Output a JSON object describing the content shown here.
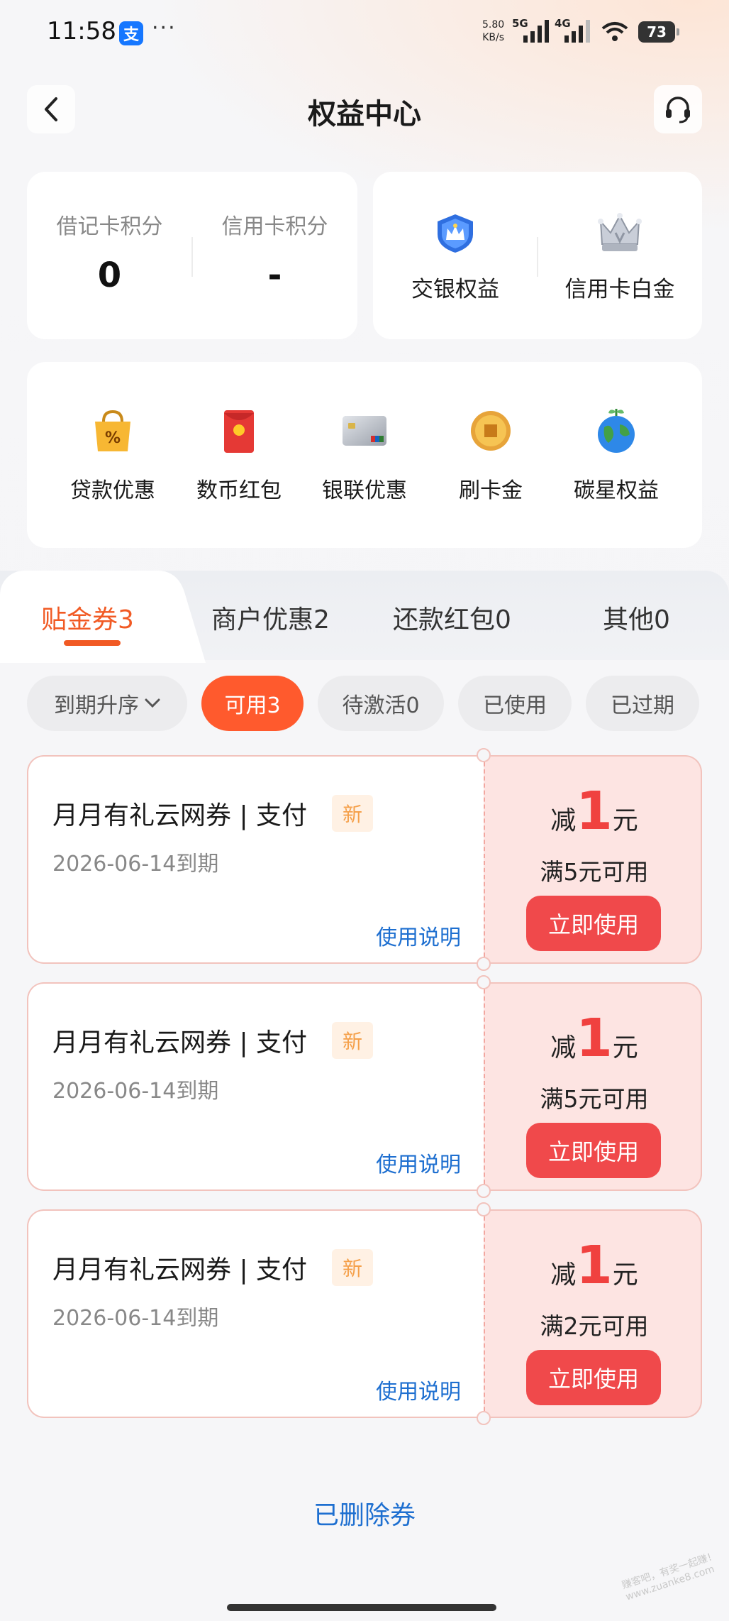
{
  "status": {
    "time": "11:58",
    "net_speed_value": "5.80",
    "net_speed_unit": "KB/s",
    "signal_1": "5G",
    "signal_2": "4G",
    "battery": "73"
  },
  "header": {
    "title": "权益中心"
  },
  "points": [
    {
      "label": "借记卡积分",
      "value": "0"
    },
    {
      "label": "信用卡积分",
      "value": "-"
    }
  ],
  "benefits": [
    {
      "label": "交银权益",
      "icon": "blue-shield-crown-icon"
    },
    {
      "label": "信用卡白金",
      "icon": "silver-crown-icon"
    }
  ],
  "shortcuts": [
    {
      "label": "贷款优惠",
      "icon": "shopping-bag-percent-icon"
    },
    {
      "label": "数币红包",
      "icon": "red-envelope-icon"
    },
    {
      "label": "银联优惠",
      "icon": "unionpay-card-icon"
    },
    {
      "label": "刷卡金",
      "icon": "gold-coin-icon"
    },
    {
      "label": "碳星权益",
      "icon": "earth-plant-icon"
    }
  ],
  "tabs": [
    "贴金券3",
    "商户优惠2",
    "还款红包0",
    "其他0"
  ],
  "filters": {
    "sort": "到期升序",
    "chips": [
      "可用3",
      "待激活0",
      "已使用",
      "已过期"
    ]
  },
  "coupons": [
    {
      "title": "月月有礼云网券 | 支付",
      "badge": "新",
      "expiry": "2026-06-14到期",
      "help": "使用说明",
      "prefix": "减",
      "amount": "1",
      "unit": "元",
      "condition": "满5元可用",
      "action": "立即使用"
    },
    {
      "title": "月月有礼云网券 | 支付",
      "badge": "新",
      "expiry": "2026-06-14到期",
      "help": "使用说明",
      "prefix": "减",
      "amount": "1",
      "unit": "元",
      "condition": "满5元可用",
      "action": "立即使用"
    },
    {
      "title": "月月有礼云网券 | 支付",
      "badge": "新",
      "expiry": "2026-06-14到期",
      "help": "使用说明",
      "prefix": "减",
      "amount": "1",
      "unit": "元",
      "condition": "满2元可用",
      "action": "立即使用"
    }
  ],
  "footer": {
    "deleted_link": "已删除券",
    "watermark": "赚客吧，有奖一起赚！ www.zuanke8.com"
  },
  "colors": {
    "accent": "#f15a24",
    "chip_active": "#ff5a2d",
    "use_button": "#f0494b",
    "link": "#1e6fd0"
  }
}
